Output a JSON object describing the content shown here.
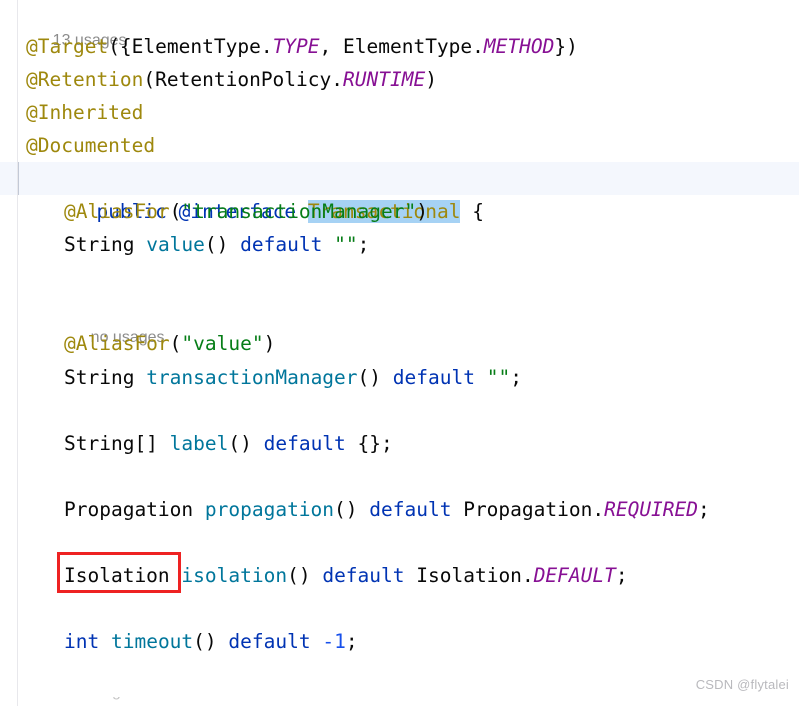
{
  "editor": {
    "app": "code-editor",
    "language": "java",
    "background": "#ffffff",
    "current_line_highlight": "#f4f7fd",
    "selection_color": "#a6d2f4",
    "annotation_box_color": "#ee2222"
  },
  "hints": {
    "usages_13": "13 usages",
    "usages_none": "no usages"
  },
  "code": {
    "l1": {
      "anno_target": "@Target",
      "open": "({",
      "elementtype1": "ElementType",
      "dot1": ".",
      "type_const": "TYPE",
      "comma": ", ",
      "elementtype2": "ElementType",
      "dot2": ".",
      "method_const": "METHOD",
      "close": "})"
    },
    "l2": {
      "anno_retention": "@Retention",
      "open": "(",
      "policy": "RetentionPolicy",
      "dot": ".",
      "runtime": "RUNTIME",
      "close": ")"
    },
    "l3": {
      "anno_inherited": "@Inherited"
    },
    "l4": {
      "anno_documented": "@Documented"
    },
    "l5": {
      "kw_public": "public",
      "kw_interface": "@interface",
      "name": "Transactional",
      "brace": "{"
    },
    "l6": {
      "anno_aliasfor": "@AliasFor",
      "paren_open": "(",
      "arg": "\"transactionManager\"",
      "paren_close": ")"
    },
    "l7": {
      "type": "String",
      "method": "value",
      "parens": "()",
      "kw_default": "default",
      "value": "\"\"",
      "semi": ";"
    },
    "l8": {
      "anno_aliasfor": "@AliasFor",
      "paren_open": "(",
      "arg": "\"value\"",
      "paren_close": ")"
    },
    "l9": {
      "type": "String",
      "method": "transactionManager",
      "parens": "()",
      "kw_default": "default",
      "value": "\"\"",
      "semi": ";"
    },
    "l10": {
      "type": "String[]",
      "method": "label",
      "parens": "()",
      "kw_default": "default",
      "value": "{}",
      "semi": ";"
    },
    "l11": {
      "type": "Propagation",
      "method": "propagation",
      "parens": "()",
      "kw_default": "default",
      "enum_type": "Propagation",
      "dot": ".",
      "enum_const": "REQUIRED",
      "semi": ";"
    },
    "l12": {
      "type": "Isolation",
      "method": "isolation",
      "parens": "()",
      "kw_default": "default",
      "enum_type": "Isolation",
      "dot": ".",
      "enum_const": "DEFAULT",
      "semi": ";"
    },
    "l13": {
      "type": "int",
      "method": "timeout",
      "parens": "()",
      "kw_default": "default",
      "value": "-1",
      "semi": ";"
    }
  },
  "watermark": {
    "text": "CSDN @flytalei"
  }
}
